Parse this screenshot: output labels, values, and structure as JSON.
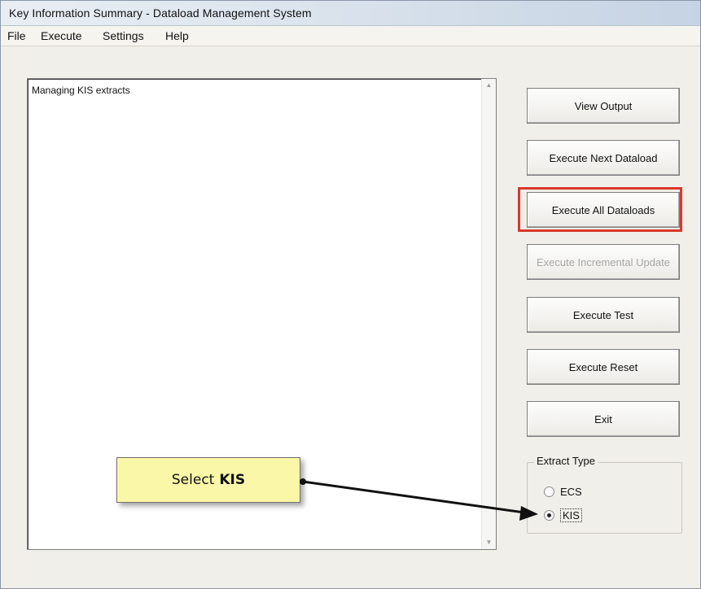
{
  "window": {
    "title": "Key Information Summary - Dataload Management System"
  },
  "menu": {
    "items": [
      "File",
      "Execute",
      "Settings",
      "Help"
    ]
  },
  "output_box": {
    "text": "Managing KIS extracts"
  },
  "buttons": {
    "view_output": "View Output",
    "execute_next": "Execute Next Dataload",
    "execute_all": "Execute All Dataloads",
    "execute_incremental": "Execute Incremental Update",
    "execute_test": "Execute Test",
    "execute_reset": "Execute Reset",
    "exit": "Exit"
  },
  "extract_type": {
    "legend": "Extract Type",
    "options": [
      {
        "label": "ECS",
        "checked": false
      },
      {
        "label": "KIS",
        "checked": true
      }
    ]
  },
  "callout": {
    "prefix": "Select",
    "bold": "KIS"
  },
  "colors": {
    "highlight": "#d9382b",
    "callout_bg": "#fbf7a8"
  }
}
